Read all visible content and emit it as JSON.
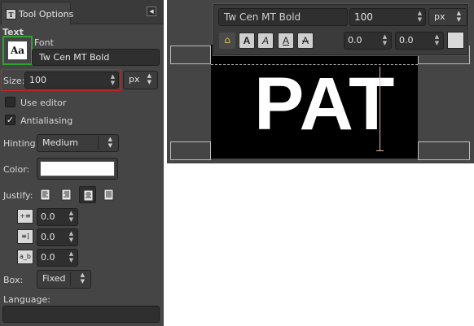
{
  "panel": {
    "tab_title": "Tool Options",
    "tab_icon": "text-tool-icon",
    "config_icon": "panel-menu-icon",
    "section_title": "Text",
    "font": {
      "label": "Font",
      "preview_glyph": "Aa",
      "value": "Tw Cen MT Bold"
    },
    "size": {
      "label": "Size:",
      "value": "100",
      "unit": "px"
    },
    "use_editor": {
      "label": "Use editor",
      "checked": false
    },
    "antialiasing": {
      "label": "Antialiasing",
      "checked": true,
      "mark": "✓"
    },
    "hinting": {
      "label": "Hinting:",
      "value": "Medium"
    },
    "color": {
      "label": "Color:",
      "swatch": "#ffffff"
    },
    "justify": {
      "label": "Justify:",
      "options": [
        "left",
        "right",
        "center",
        "fill"
      ],
      "selected": "center"
    },
    "indent": {
      "icon": "indent-icon",
      "value": "0.0"
    },
    "line_spacing": {
      "icon": "line-spacing-icon",
      "value": "0.0"
    },
    "letter_spacing": {
      "icon": "letter-spacing-icon",
      "icon_text": "a_b",
      "value": "0.0"
    },
    "box": {
      "label": "Box:",
      "value": "Fixed"
    },
    "language": {
      "label": "Language:",
      "value": ""
    }
  },
  "canvas": {
    "text": "PAT",
    "background": "#000000",
    "text_color": "#ffffff",
    "toolbox": {
      "font": "Tw Cen MT Bold",
      "size": "100",
      "unit": "px",
      "clear_icon": "clear-style-icon",
      "style_buttons": [
        "bold",
        "italic",
        "underline",
        "strikethrough"
      ],
      "style_glyph": "A",
      "baseline": "0.0",
      "kerning": "0.0",
      "color": "#d8d8d8"
    }
  },
  "colors": {
    "panel_bg": "#454545",
    "field_bg": "#2f2f2f",
    "font_highlight": "#2fa52f",
    "size_highlight": "#d41f1f"
  }
}
